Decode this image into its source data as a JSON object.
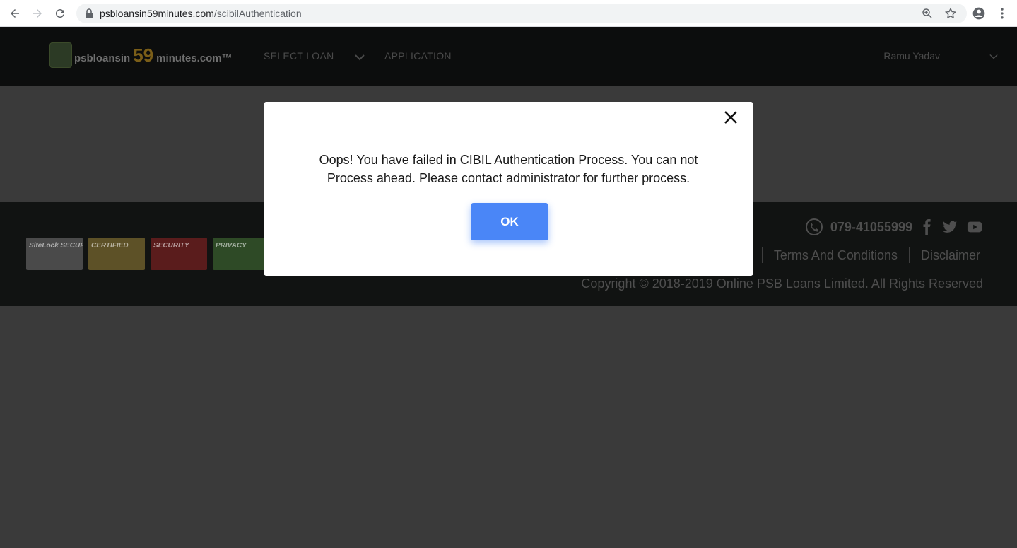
{
  "browser": {
    "url_host": "psbloansin59minutes.com",
    "url_path": "/scibilAuthentication"
  },
  "header": {
    "logo": {
      "prefix": "psbloansin",
      "number": "59",
      "suffix": "minutes.com™"
    },
    "nav": {
      "select_loan": "SELECT LOAN",
      "application": "APPLICATION"
    },
    "user_name": "Ramu Yadav"
  },
  "footer": {
    "badges": {
      "sitelock": "SiteLock SECURE",
      "certified": "CERTIFIED",
      "security": "SECURITY",
      "privacy": "PRIVACY"
    },
    "phone": "079-41055999",
    "links": {
      "terms": "Terms And Conditions",
      "disclaimer": "Disclaimer"
    },
    "copyright": "Copyright © 2018-2019 Online PSB Loans Limited. All Rights Reserved"
  },
  "modal": {
    "message": "Oops! You have failed in CIBIL Authentication Process. You can not Process ahead. Please contact administrator for further process.",
    "ok_label": "OK"
  },
  "colors": {
    "ok_button": "#4a86f7",
    "overlay": "#3a3a3a",
    "modal_bg": "#ffffff"
  },
  "icons": [
    "back-arrow-icon",
    "forward-arrow-icon",
    "reload-icon",
    "lock-icon",
    "zoom-icon",
    "star-icon",
    "account-icon",
    "menu-dots-icon",
    "chevron-down-icon",
    "phone-icon",
    "facebook-icon",
    "twitter-icon",
    "youtube-icon",
    "close-icon"
  ]
}
